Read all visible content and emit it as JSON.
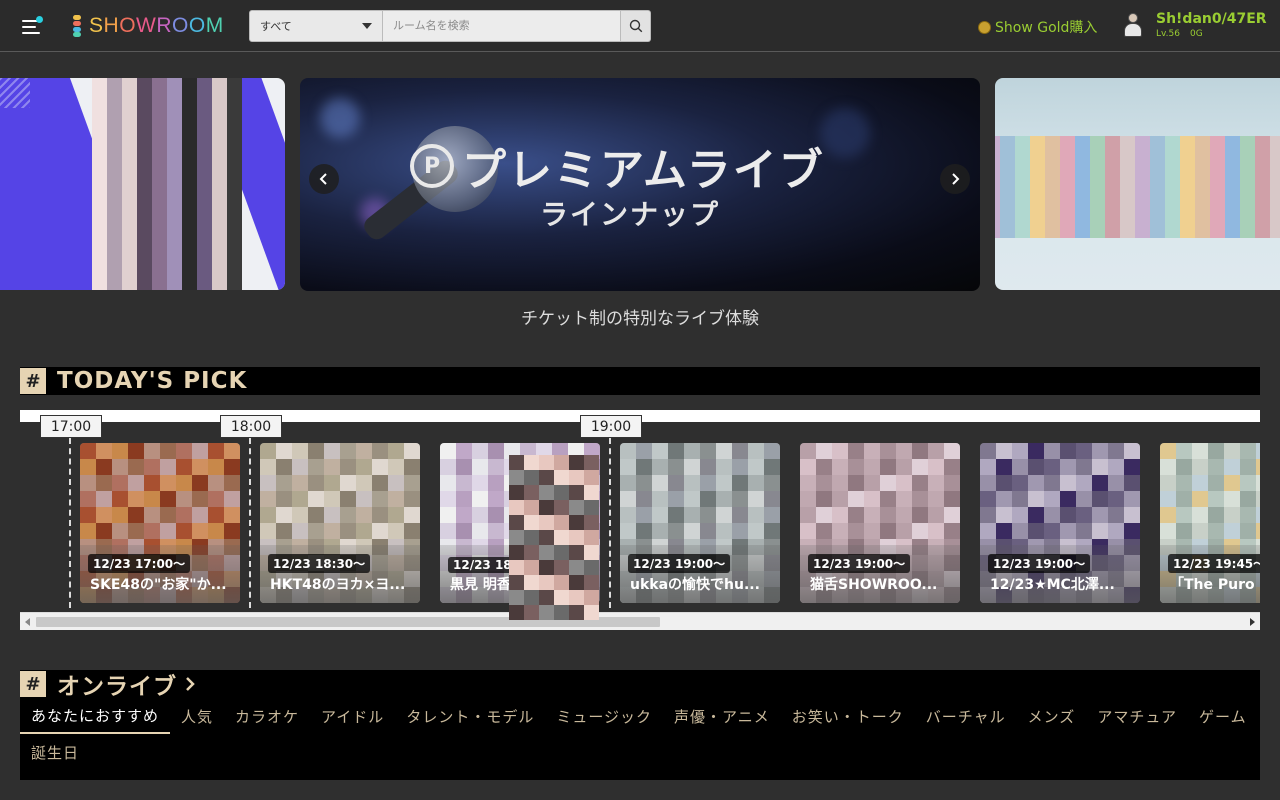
{
  "header": {
    "logo_text": "SHOWROOM",
    "search_scope": "すべて",
    "search_placeholder": "ルーム名を検索",
    "gold_label": "Show Gold購入",
    "user_name": "Sh!dan0/47ER",
    "user_level": "Lv.56",
    "user_gold": "0G"
  },
  "banner": {
    "main_title": "プレミアムライブ",
    "main_subtitle": "ラインナップ",
    "badge": "P",
    "caption": "チケット制の特別なライブ体験"
  },
  "todays_pick": {
    "hash": "#",
    "title": "TODAY'S PICK",
    "time_markers": [
      "17:00",
      "18:00",
      "19:00"
    ],
    "cards": [
      {
        "time": "12/23 17:00～",
        "title": "SKE48の\"お家\"か..."
      },
      {
        "time": "12/23 18:30～",
        "title": "HKT48のヨカ×ヨ..."
      },
      {
        "time": "12/23 18:",
        "title": "黒見 明香"
      },
      {
        "time": "12/23 19:00～",
        "title": "ukkaの愉快でhu..."
      },
      {
        "time": "12/23 19:00～",
        "title": "猫舌SHOWROO..."
      },
      {
        "time": "12/23 19:00～",
        "title": "12/23★MC北澤..."
      },
      {
        "time": "12/23 19:45～",
        "title": "「The Puro"
      }
    ]
  },
  "on_live": {
    "hash": "#",
    "title": "オンライブ",
    "categories": [
      "あなたにおすすめ",
      "人気",
      "カラオケ",
      "アイドル",
      "タレント・モデル",
      "ミュージック",
      "声優・アニメ",
      "お笑い・トーク",
      "バーチャル",
      "メンズ",
      "アマチュア",
      "ゲーム",
      "誕生日"
    ],
    "active_category": "あなたにおすすめ"
  },
  "colors": {
    "background": "#2f2f2f",
    "accent_beige": "#e6d4b3",
    "user_green": "#9acd32",
    "banner_purple": "#5544e6"
  }
}
